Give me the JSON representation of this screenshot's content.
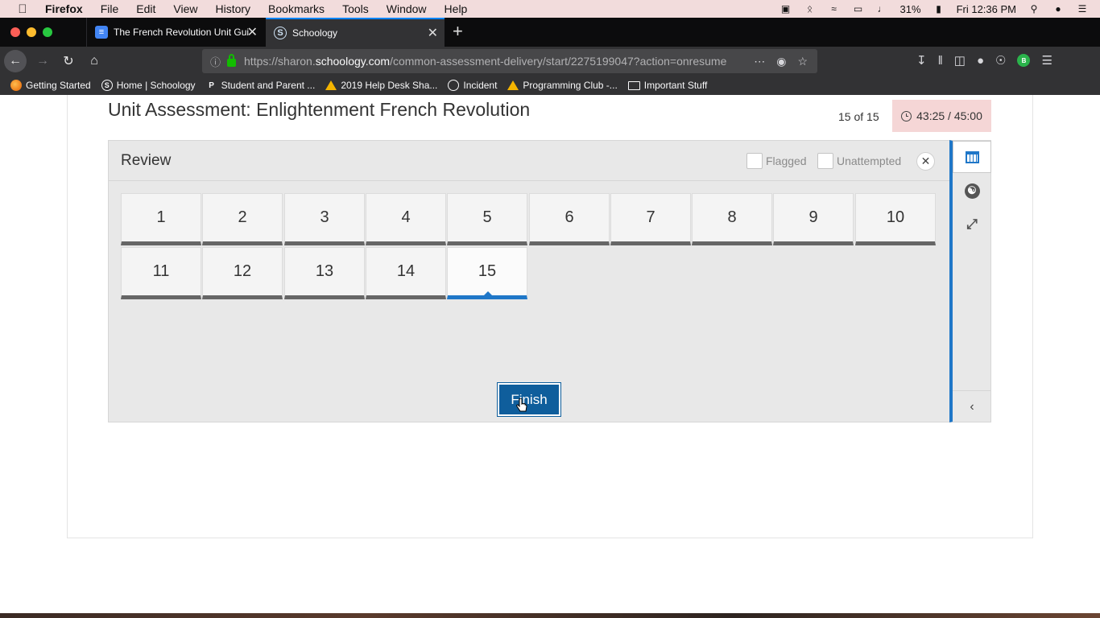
{
  "menubar": {
    "apple_icon": "apple-logo",
    "app_name": "Firefox",
    "items": [
      "File",
      "Edit",
      "View",
      "History",
      "Bookmarks",
      "Tools",
      "Window",
      "Help"
    ],
    "battery_percent": "31%",
    "clock": "Fri 12:36 PM"
  },
  "tabs": [
    {
      "title": "The French Revolution Unit Guide",
      "icon": "google-docs-icon"
    },
    {
      "title": "Schoology",
      "icon": "schoology-icon",
      "active": true
    }
  ],
  "navbar": {
    "url_host_prefix": "https://sharon.",
    "url_host": "schoology.com",
    "url_path": "/common-assessment-delivery/start/2275199047?action=onresume"
  },
  "bookmarks": [
    {
      "label": "Getting Started",
      "icon": "firefox-icon"
    },
    {
      "label": "Home | Schoology",
      "icon": "schoology-icon"
    },
    {
      "label": "Student and Parent ...",
      "icon": "p-icon"
    },
    {
      "label": "2019 Help Desk Sha...",
      "icon": "drive-icon"
    },
    {
      "label": "Incident",
      "icon": "globe-icon"
    },
    {
      "label": "Programming Club -...",
      "icon": "drive-icon"
    },
    {
      "label": "Important Stuff",
      "icon": "folder-icon"
    }
  ],
  "assessment": {
    "title": "Unit Assessment: Enlightenment French Revolution",
    "counter": "15 of 15",
    "timer": "43:25 / 45:00"
  },
  "review": {
    "title": "Review",
    "filter_flagged": "Flagged",
    "filter_unattempted": "Unattempted",
    "questions": [
      "1",
      "2",
      "3",
      "4",
      "5",
      "6",
      "7",
      "8",
      "9",
      "10",
      "11",
      "12",
      "13",
      "14",
      "15"
    ],
    "current_question": "15",
    "finish_label": "Finish"
  },
  "colors": {
    "accent": "#1f77c8",
    "finish_button": "#0f5e9c",
    "timer_background": "#f5d6d6"
  }
}
